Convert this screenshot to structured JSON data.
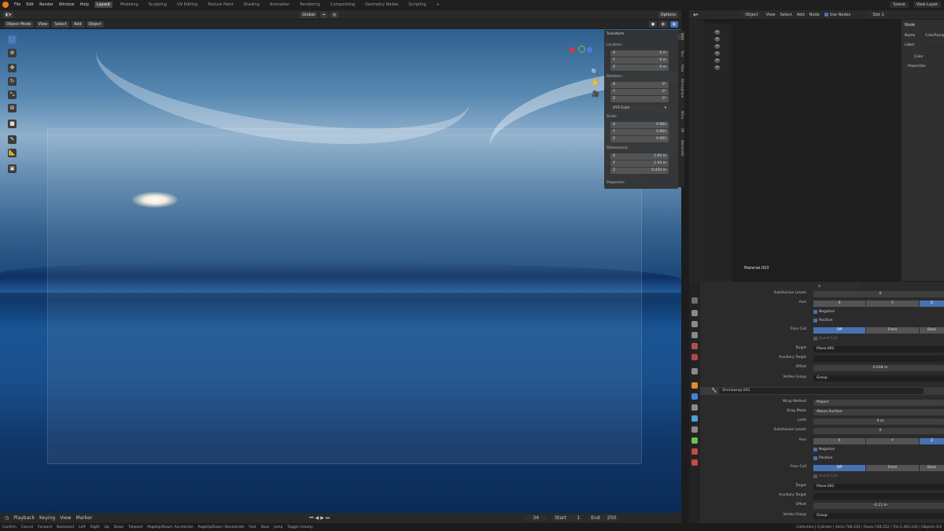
{
  "app": {
    "menus": [
      "File",
      "Edit",
      "Render",
      "Window",
      "Help"
    ],
    "workspaces": [
      "Layout",
      "Modeling",
      "Sculpting",
      "UV Editing",
      "Texture Paint",
      "Shading",
      "Animation",
      "Rendering",
      "Compositing",
      "Geometry Nodes",
      "Scripting",
      "+"
    ],
    "scene": "Scene",
    "view_layer": "View Layer"
  },
  "viewport": {
    "orientation": "Global",
    "options": "Options",
    "mode": "Object Mode",
    "menus": [
      "View",
      "Select",
      "Add",
      "Object"
    ]
  },
  "npanel": {
    "title": "Transform",
    "location_label": "Location:",
    "loc": [
      "0 m",
      "0 m",
      "0 m"
    ],
    "rotation_label": "Rotation:",
    "rot": [
      "0°",
      "0°",
      "0°"
    ],
    "euler": "XYZ Euler",
    "scale_label": "Scale:",
    "scale": [
      "0.963",
      "0.963",
      "0.963"
    ],
    "dimensions_label": "Dimensions:",
    "dims": [
      "1.92 m",
      "1.93 m",
      "0.454 m"
    ],
    "axes": [
      "X",
      "Y",
      "Z"
    ],
    "properties": "Properties",
    "tabs": [
      "Item",
      "Tool",
      "View",
      "Atmosphere",
      "Mirra",
      "VR",
      "BlenderKit"
    ]
  },
  "timeline": {
    "menus": [
      "Playback",
      "Keying",
      "View",
      "Marker"
    ],
    "frame": "34",
    "start_label": "Start",
    "start": "1",
    "end_label": "End",
    "end": "250"
  },
  "status": {
    "items": [
      "Confirm",
      "Cancel",
      "Forward",
      "Backward",
      "Left",
      "Right",
      "Up",
      "Down",
      "Teleport",
      "Fast",
      "Slow",
      "Jump",
      "Toggle Gravity"
    ],
    "accel": "PageUp/Down: Accelerate",
    "decel": "PageUp/Down: Decelerate",
    "stats": "Collection | Cylinder | Verts:748,335 | Faces:748,552 | Tris:1,493,104 | Objects:1/4"
  },
  "node": {
    "object": "Object",
    "menus": [
      "View",
      "Select",
      "Add",
      "Node"
    ],
    "use_nodes": "Use Nodes",
    "slot": "Slot 1",
    "material": "Material.003",
    "side_title": "Node",
    "name_label": "Name",
    "name_value": "ColorRamp",
    "label_label": "Label",
    "color": "Color",
    "properties": "Properties"
  },
  "modifiers": {
    "subdiv_levels_label": "Subdivision Levels",
    "subdiv_top": "0",
    "axis_label": "Axis",
    "axes": [
      "X",
      "Y",
      "Z"
    ],
    "negative": "Negative",
    "positive": "Positive",
    "face_cull_label": "Face Cull",
    "face_cull": [
      "Off",
      "Front",
      "Back"
    ],
    "invert_cull": "Invert Cull",
    "target_label": "Target",
    "target1": "Plane.002",
    "aux_target_label": "Auxiliary Target",
    "offset_label": "Offset",
    "offset1": "0.018 m",
    "vgroup_label": "Vertex Group",
    "vgroup": "Group",
    "modifier2_name": "Shrinkwrap.001",
    "wrap_method_label": "Wrap Method",
    "wrap_method": "Project",
    "snap_mode_label": "Snap Mode",
    "snap_mode": "Above Surface",
    "limit_label": "Limit",
    "limit": "0 m",
    "subdiv2": "0",
    "target2": "Plane.002",
    "offset2": "-0.11 m",
    "vgroup2": "Group"
  }
}
